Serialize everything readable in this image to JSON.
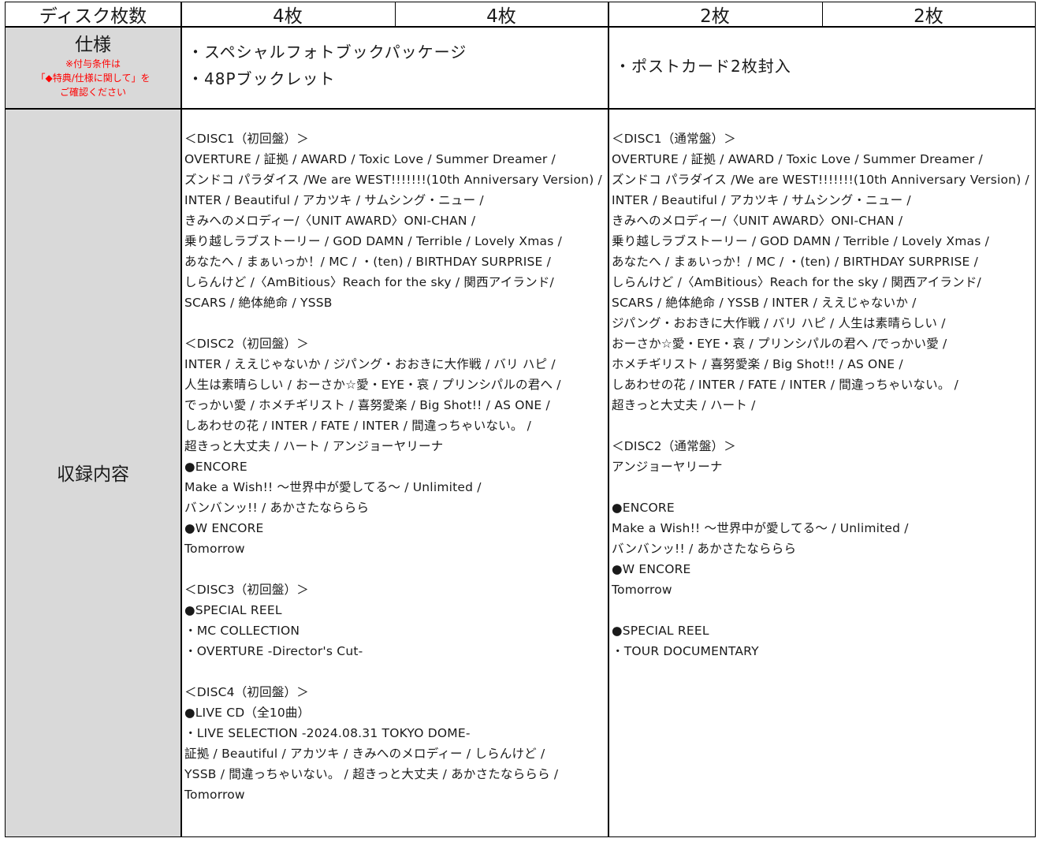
{
  "header": {
    "label": "ディスク枚数",
    "counts": [
      "4枚",
      "4枚",
      "2枚",
      "2枚"
    ]
  },
  "spec_row": {
    "label": "仕様",
    "note_lines": [
      "※付与条件は",
      "「◆特典/仕様に関して」を",
      "ご確認ください"
    ],
    "left": [
      "・スペシャルフォトブックパッケージ",
      "・48Pブックレット"
    ],
    "right": [
      "・ポストカード2枚封入"
    ]
  },
  "contents_row": {
    "label": "収録内容",
    "left_lines": [
      "＜DISC1（初回盤）＞",
      "OVERTURE / 証拠 / AWARD / Toxic Love / Summer Dreamer /",
      "ズンドコ パラダイス /We are WEST!!!!!!!(10th Anniversary Version) /",
      "INTER / Beautiful / アカツキ / サムシング・ニュー /",
      "きみへのメロディー/〈UNIT AWARD〉ONI-CHAN /",
      "乗り越しラブストーリー / GOD DAMN / Terrible / Lovely Xmas /",
      "あなたへ / まぁいっか！/ MC / ・(ten) / BIRTHDAY SURPRISE /",
      "しらんけど /〈AmBitious〉Reach for the sky / 関西アイランド/",
      "SCARS / 絶体絶命 / YSSB",
      "",
      "＜DISC2（初回盤）＞",
      "INTER / ええじゃないか / ジパング・おおきに大作戦 / バリ ハピ /",
      "人生は素晴らしい / おーさか☆愛・EYE・哀 / プリンシパルの君へ /",
      "でっかい愛 / ホメチギリスト / 喜努愛楽 / Big Shot!! / AS ONE /",
      "しあわせの花 / INTER / FATE / INTER / 間違っちゃいない。 /",
      "超きっと大丈夫 / ハート / アンジョーヤリーナ",
      "●ENCORE",
      "Make a Wish!! 〜世界中が愛してる〜 / Unlimited /",
      "バンバンッ!! / あかさたなららら",
      "●W ENCORE",
      "Tomorrow",
      "",
      "＜DISC3（初回盤）＞",
      "●SPECIAL REEL",
      "・MC COLLECTION",
      "・OVERTURE -Director's Cut-",
      "",
      "＜DISC4（初回盤）＞",
      "●LIVE CD（全10曲）",
      "・LIVE SELECTION -2024.08.31 TOKYO DOME-",
      "証拠 / Beautiful / アカツキ / きみへのメロディー / しらんけど /",
      "YSSB / 間違っちゃいない。 / 超きっと大丈夫 / あかさたなららら /",
      "Tomorrow"
    ],
    "right_lines": [
      "＜DISC1（通常盤）＞",
      "OVERTURE / 証拠 / AWARD / Toxic Love / Summer Dreamer /",
      "ズンドコ パラダイス /We are WEST!!!!!!!(10th Anniversary Version) /",
      "INTER / Beautiful / アカツキ / サムシング・ニュー /",
      "きみへのメロディー/〈UNIT AWARD〉ONI-CHAN /",
      "乗り越しラブストーリー / GOD DAMN / Terrible / Lovely Xmas /",
      "あなたへ / まぁいっか！/ MC / ・(ten) / BIRTHDAY SURPRISE /",
      "しらんけど /〈AmBitious〉Reach for the sky / 関西アイランド/",
      "SCARS / 絶体絶命 / YSSB / INTER / ええじゃないか /",
      "ジパング・おおきに大作戦 / バリ ハピ / 人生は素晴らしい /",
      "おーさか☆愛・EYE・哀 / プリンシパルの君へ /でっかい愛 /",
      "ホメチギリスト / 喜努愛楽 / Big Shot!! / AS ONE /",
      "しあわせの花 / INTER / FATE / INTER / 間違っちゃいない。 /",
      "超きっと大丈夫 / ハート /",
      "",
      "＜DISC2（通常盤）＞",
      "アンジョーヤリーナ",
      "",
      "●ENCORE",
      "Make a Wish!! 〜世界中が愛してる〜 / Unlimited /",
      "バンバンッ!! / あかさたなららら",
      "●W ENCORE",
      "Tomorrow",
      "",
      "●SPECIAL REEL",
      "・TOUR DOCUMENTARY"
    ]
  }
}
